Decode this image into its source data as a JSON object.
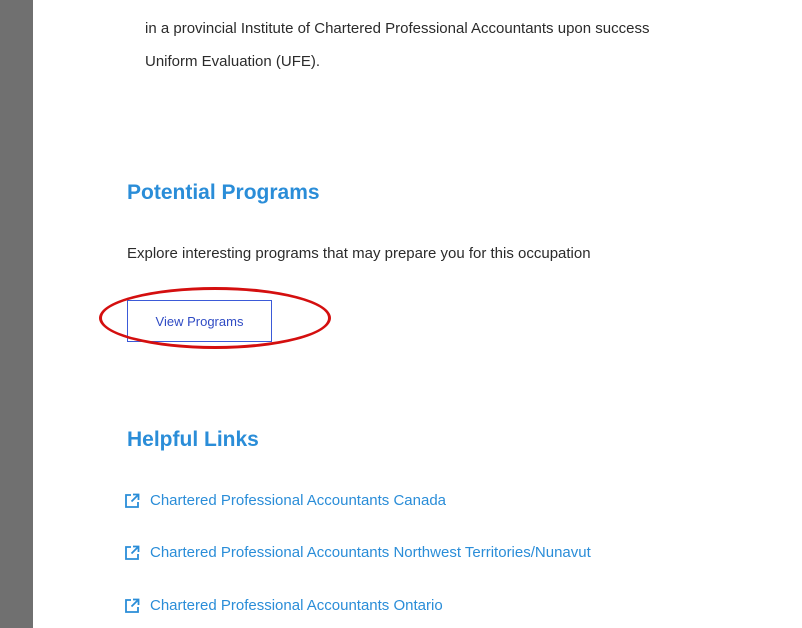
{
  "intro": {
    "line1": "in a provincial Institute of Chartered Professional Accountants upon success",
    "line2": "Uniform Evaluation (UFE)."
  },
  "potential_programs": {
    "heading": "Potential Programs",
    "description": "Explore interesting programs that may prepare you for this occupation",
    "button_label": "View Programs"
  },
  "helpful_links": {
    "heading": "Helpful Links",
    "items": [
      {
        "label": "Chartered Professional Accountants Canada",
        "icon": "external-link-icon"
      },
      {
        "label": "Chartered Professional Accountants Northwest Territories/Nunavut",
        "icon": "external-link-icon"
      },
      {
        "label": "Chartered Professional Accountants Ontario",
        "icon": "external-link-icon"
      }
    ]
  },
  "colors": {
    "heading": "#2a8dd8",
    "link": "#2a8dd8",
    "button_border": "#3b5ad8",
    "highlight_ring": "#d40f0f",
    "left_bar": "#707070"
  }
}
